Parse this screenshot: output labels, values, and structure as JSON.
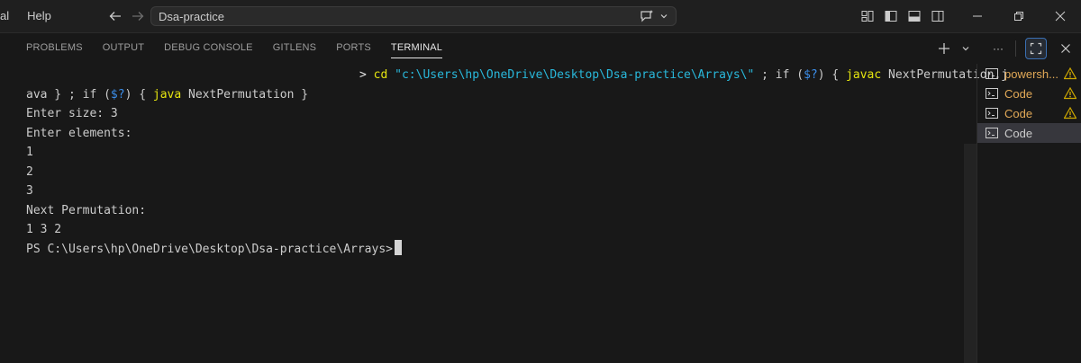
{
  "titlebar": {
    "menu": [
      "al",
      "Help"
    ],
    "search_text": "Dsa-practice"
  },
  "panel": {
    "tabs": [
      "PROBLEMS",
      "OUTPUT",
      "DEBUG CONSOLE",
      "GITLENS",
      "PORTS",
      "TERMINAL"
    ],
    "active_tab": "TERMINAL",
    "more_label": "···"
  },
  "terminal": {
    "line1": {
      "prompt": "> ",
      "cd": "cd ",
      "path": "\"c:\\Users\\hp\\OneDrive\\Desktop\\Dsa-practice\\Arrays\\\"",
      "mid": " ; if (",
      "var": "$?",
      "mid2": ") { ",
      "javac": "javac",
      "rest": " NextPermutation.j"
    },
    "line2": {
      "start": "ava } ; if (",
      "var": "$?",
      "mid": ") { ",
      "java": "java",
      "rest": " NextPermutation }"
    },
    "output": [
      "Enter size: 3",
      "Enter elements:",
      "1",
      "2",
      "3",
      "Next Permutation:",
      "1 3 2"
    ],
    "prompt_line": "PS C:\\Users\\hp\\OneDrive\\Desktop\\Dsa-practice\\Arrays>"
  },
  "terminal_list": [
    {
      "label": "powersh...",
      "warning": true,
      "active": false
    },
    {
      "label": "Code",
      "warning": true,
      "active": false
    },
    {
      "label": "Code",
      "warning": true,
      "active": false
    },
    {
      "label": "Code",
      "warning": false,
      "active": true
    }
  ],
  "colors": {
    "accent": "#0078d4",
    "warning": "#cca700"
  }
}
